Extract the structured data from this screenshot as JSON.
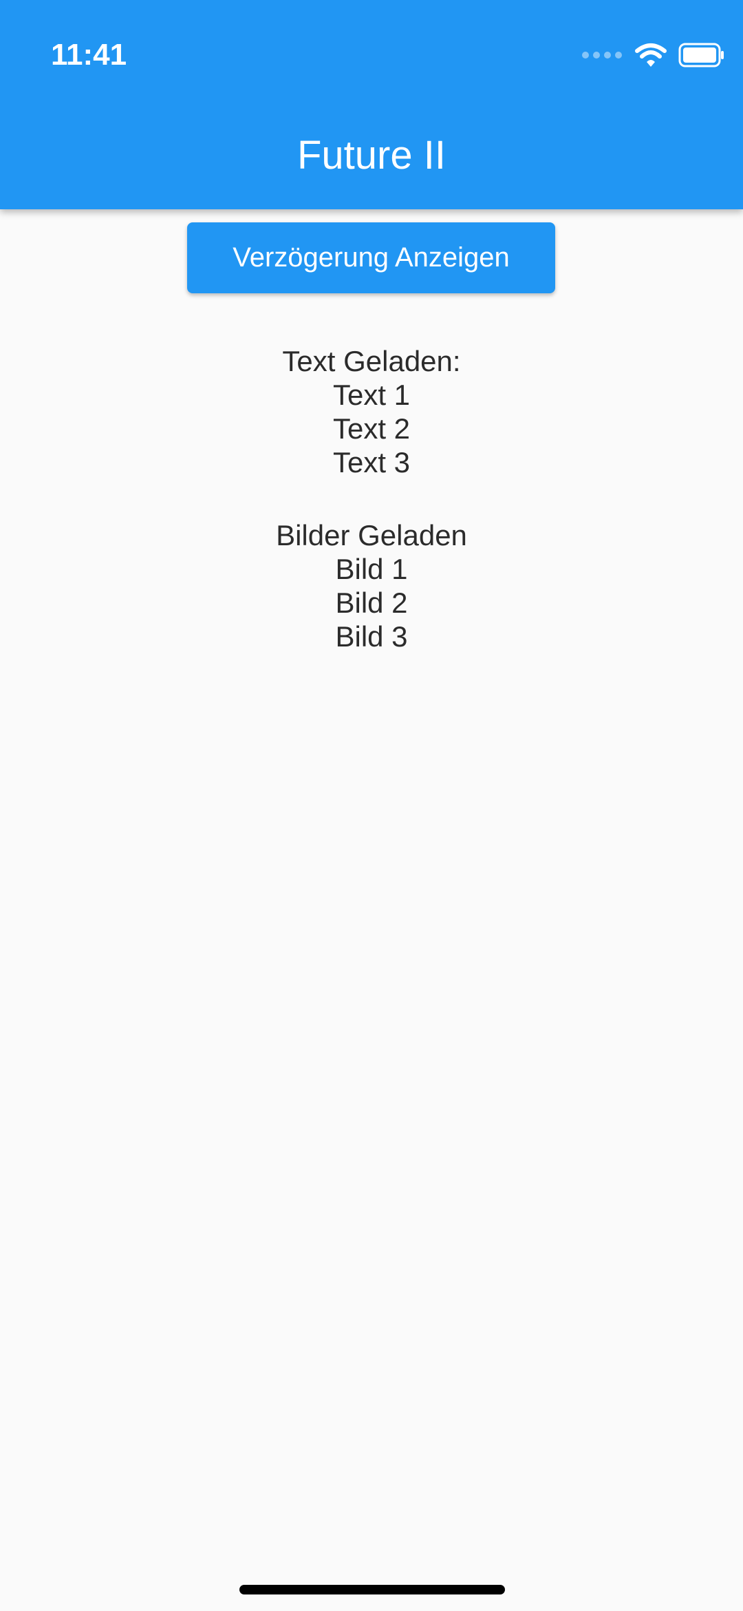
{
  "status_bar": {
    "time": "11:41"
  },
  "app_bar": {
    "title": "Future II",
    "color": "#2196f3"
  },
  "button": {
    "label": "Verzögerung Anzeigen"
  },
  "text_block": {
    "heading": "Text Geladen:",
    "items": [
      "Text 1",
      "Text 2",
      "Text 3"
    ]
  },
  "image_block": {
    "heading": "Bilder Geladen",
    "items": [
      "Bild 1",
      "Bild 2",
      "Bild 3"
    ]
  },
  "icons": [
    "wifi-icon",
    "battery-icon",
    "cellular-signal-icon"
  ]
}
